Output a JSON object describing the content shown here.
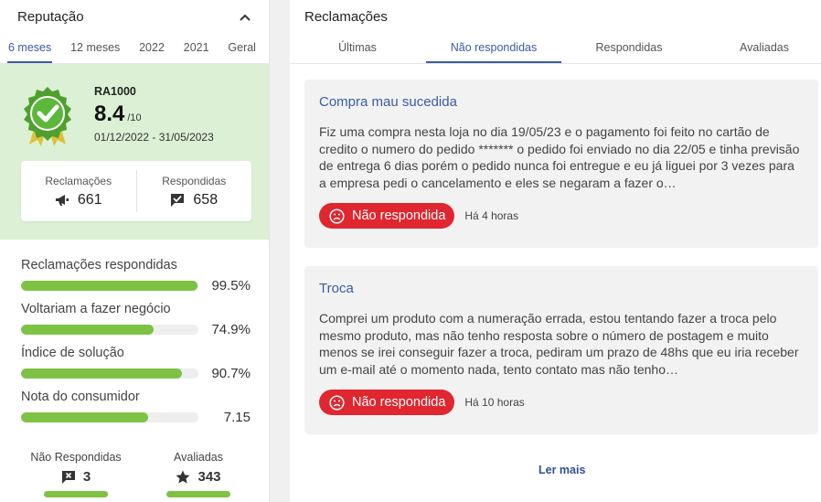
{
  "reputation": {
    "title": "Reputação",
    "period_tabs": [
      "6 meses",
      "12 meses",
      "2022",
      "2021",
      "Geral"
    ],
    "active_period": 0,
    "ra_label": "RA1000",
    "score": "8.4",
    "score_max": "/10",
    "date_range": "01/12/2022 - 31/05/2023",
    "counts": {
      "complaints_label": "Reclamações",
      "complaints_value": "661",
      "answered_label": "Respondidas",
      "answered_value": "658"
    },
    "metrics": [
      {
        "label": "Reclamações respondidas",
        "value": "99.5%",
        "fill_pct": 99.5
      },
      {
        "label": "Voltariam a fazer negócio",
        "value": "74.9%",
        "fill_pct": 74.9
      },
      {
        "label": "Índice de solução",
        "value": "90.7%",
        "fill_pct": 90.7
      },
      {
        "label": "Nota do consumidor",
        "value": "7.15",
        "fill_pct": 71.5
      }
    ],
    "bottom_stats": [
      {
        "label": "Não Respondidas",
        "value": "3",
        "icon": "unanswered-icon"
      },
      {
        "label": "Avaliadas",
        "value": "343",
        "icon": "star-icon"
      }
    ]
  },
  "complaints": {
    "title": "Reclamações",
    "tabs": [
      "Últimas",
      "Não respondidas",
      "Respondidas",
      "Avaliadas"
    ],
    "active_tab": 1,
    "items": [
      {
        "title": "Compra mau sucedida",
        "text": "Fiz uma compra nesta loja no dia 19/05/23 e o pagamento foi feito no cartão de credito o numero do pedido ******* o pedido foi enviado no dia 22/05 e tinha previsão de entrega 6 dias porém o pedido nunca foi entregue e eu já liguei por 3 vezes para a empresa pedi o cancelamento e eles se negaram a fazer o…",
        "status": "Não respondida",
        "time": "Há 4 horas"
      },
      {
        "title": "Troca",
        "text": "Comprei um produto com a numeração errada, estou tentando fazer a troca pelo mesmo produto, mas não tenho resposta sobre o número de postagem e muito menos se irei conseguir fazer a troca, pediram um prazo de 48hs que eu iria receber um e-mail até o momento nada, tento contato mas não tenho…",
        "status": "Não respondida",
        "time": "Há 10 horas"
      }
    ],
    "more_label": "Ler mais"
  },
  "colors": {
    "accent": "#3a5ba8",
    "score_bg": "#dcf0d5",
    "bar_green": "#7dc243",
    "status_red": "#e0262f"
  }
}
